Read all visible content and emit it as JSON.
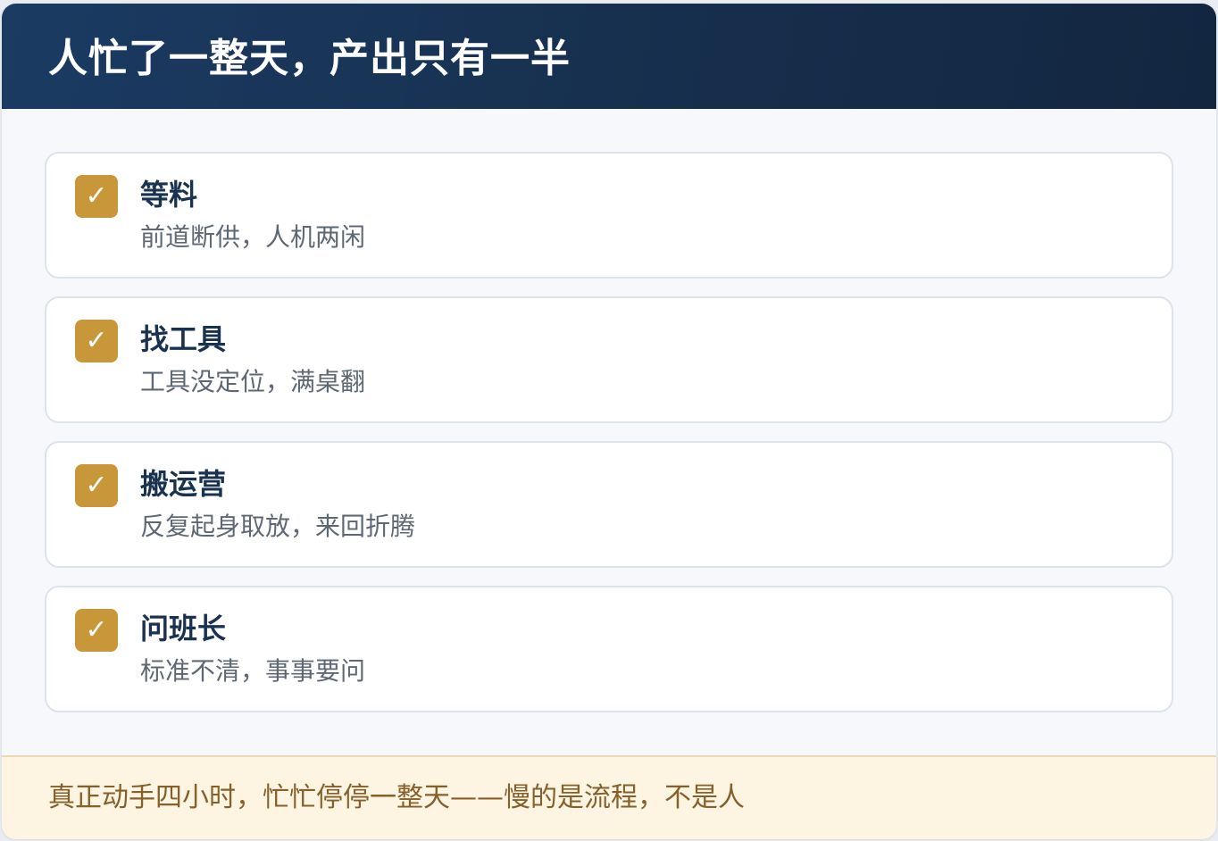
{
  "header": {
    "title": "人忙了一整天，产出只有一半"
  },
  "items": [
    {
      "icon": "checkmark-icon",
      "check_glyph": "✓",
      "title": "等料",
      "desc": "前道断供，人机两闲"
    },
    {
      "icon": "checkmark-icon",
      "check_glyph": "✓",
      "title": "找工具",
      "desc": "工具没定位，满桌翻"
    },
    {
      "icon": "checkmark-icon",
      "check_glyph": "✓",
      "title": "搬运营",
      "desc": "反复起身取放，来回折腾"
    },
    {
      "icon": "checkmark-icon",
      "check_glyph": "✓",
      "title": "问班长",
      "desc": "标准不清，事事要问"
    }
  ],
  "footer": {
    "text": "真正动手四小时，忙忙停停一整天——慢的是流程，不是人"
  },
  "colors": {
    "header_bg": "#1b3b63",
    "accent": "#c7973a",
    "footer_bg": "#fdf4e2",
    "footer_text": "#86602a"
  }
}
